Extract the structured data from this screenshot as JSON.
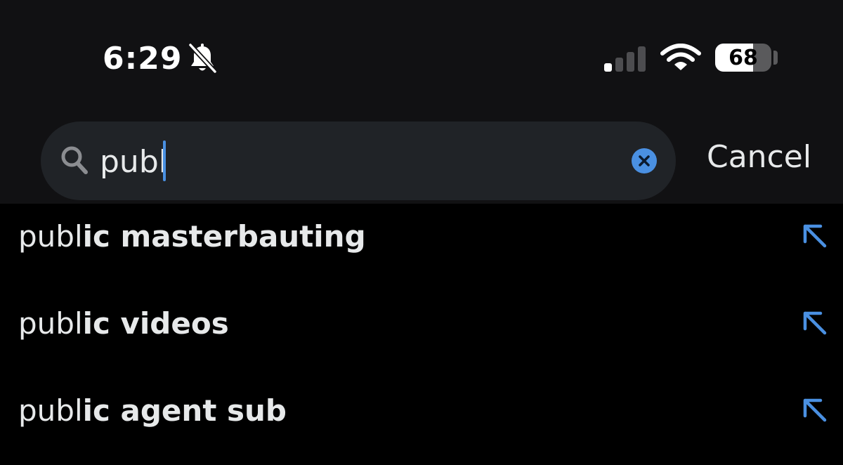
{
  "status_bar": {
    "time": "6:29",
    "battery_level": "68",
    "battery_fraction": 0.68,
    "signal_bars_active": 1,
    "signal_bars_total": 4
  },
  "search": {
    "query": "publ",
    "placeholder": "",
    "cancel_label": "Cancel"
  },
  "suggestions": [
    {
      "typed": "publ",
      "completion": "ic masterbauting"
    },
    {
      "typed": "publ",
      "completion": "ic videos"
    },
    {
      "typed": "publ",
      "completion": "ic agent sub"
    }
  ],
  "icons": {
    "bell": "bell-slash-icon",
    "signal": "cellular-signal-icon",
    "wifi": "wifi-icon",
    "search": "search-icon",
    "clear": "clear-x-icon",
    "fill": "arrow-up-left-icon"
  },
  "colors": {
    "background": "#000000",
    "header_background": "#111113",
    "search_field": "#202327",
    "accent": "#4a90e2",
    "text": "#e7e9ea"
  }
}
